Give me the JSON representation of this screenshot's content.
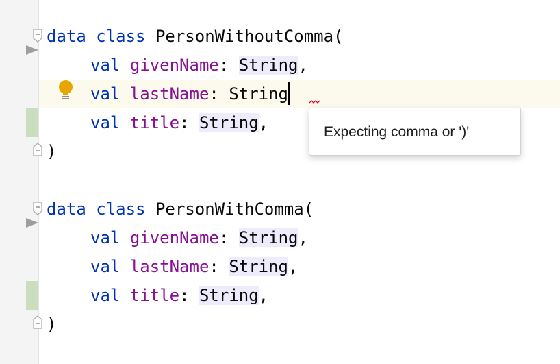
{
  "editor": {
    "colors": {
      "keyword": "#0033b3",
      "property": "#871094",
      "type_highlight": "#edebfc",
      "current_line": "#fcfaed",
      "change_marker": "#c9dec1",
      "gutter": "#f4f4f4",
      "bulb": "#e8a500",
      "error_squiggle": "#e0001a"
    },
    "icons": {
      "run": "run-gutter-icon",
      "fold": "fold-icon",
      "intention": "lightbulb-icon"
    },
    "blocks": [
      {
        "header": {
          "kw1": "data",
          "kw2": "class",
          "name": "PersonWithoutComma",
          "open": "("
        },
        "params": [
          {
            "kw": "val",
            "name": "givenName",
            "colon": ": ",
            "type": "String",
            "tail": ","
          },
          {
            "kw": "val",
            "name": "lastName",
            "colon": ": ",
            "type": "String",
            "tail": ""
          },
          {
            "kw": "val",
            "name": "title",
            "colon": ": ",
            "type": "String",
            "tail": ","
          }
        ],
        "close": ")"
      },
      {
        "header": {
          "kw1": "data",
          "kw2": "class",
          "name": "PersonWithComma",
          "open": "("
        },
        "params": [
          {
            "kw": "val",
            "name": "givenName",
            "colon": ": ",
            "type": "String",
            "tail": ","
          },
          {
            "kw": "val",
            "name": "lastName",
            "colon": ": ",
            "type": "String",
            "tail": ","
          },
          {
            "kw": "val",
            "name": "title",
            "colon": ": ",
            "type": "String",
            "tail": ","
          }
        ],
        "close": ")"
      }
    ]
  },
  "tooltip": {
    "message": "Expecting comma or ')'"
  }
}
